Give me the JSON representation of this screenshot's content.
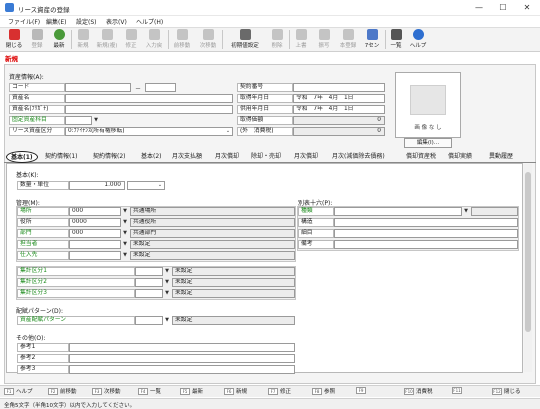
{
  "window": {
    "title": "リース資産の登録",
    "minimize": "—",
    "maximize": "☐",
    "close": "✕"
  },
  "menu": [
    "ファイル(F)",
    "編集(E)",
    "設定(S)",
    "表示(V)",
    "ヘルプ(H)"
  ],
  "toolbar": {
    "close": "閉じる",
    "register": "登録",
    "refresh": "最新",
    "new": "新規",
    "new_copy": "新規(複)",
    "edit": "修正",
    "import": "入力戻",
    "prev": "前移動",
    "next": "次移動",
    "initial_settings": "初期値設定",
    "delete": "削除",
    "overwrite": "上書",
    "copy": "振写",
    "this_period": "本登録",
    "fuzen": "7セン",
    "list": "一覧",
    "help": "ヘルプ"
  },
  "mode_label": "新規",
  "asset_info": {
    "header": "資産情報(A):",
    "code_label": "コード",
    "code_dash": "－",
    "name_label": "資産名",
    "kana_label": "資産名(ﾌﾘｶﾞﾅ)",
    "fixed_subject_label": "固定資産科目",
    "category_label": "リース資産区分",
    "category_value": "0:ﾌｧｲﾅﾝｽ(所有権移転)",
    "contract_no_label": "契約番号",
    "acquisition_date_label": "取得年月日",
    "acquisition_date_value": "令和　7年　4月　1日",
    "use_date_label": "供用年月日",
    "use_date_value": "令和　7年　4月　1日",
    "acquisition_price_label": "取得価額",
    "acquisition_price_value": "0",
    "tax_label": "(外　消費税)",
    "tax_value": "0"
  },
  "image_box": {
    "no_image": "画 像 な し",
    "edit_button": "編集(I)..."
  },
  "tabs": [
    "基本(1)",
    "契約情報(1)",
    "契約情報(2)",
    "基本(2)",
    "月次支払額",
    "月次償却",
    "除却・売却",
    "月次償却",
    "月次(減価除去債務)",
    "償却資産税",
    "償却実績",
    "異動履歴"
  ],
  "basic": {
    "header": "基本(K):",
    "qty_label": "数量・単位",
    "qty_value": "1.000",
    "management_header": "管理(M):",
    "mgmt_rows": [
      {
        "label": "場所",
        "code": "000",
        "name": "共通場所"
      },
      {
        "label": "役所",
        "code": "0000",
        "name": "共通役所"
      },
      {
        "label": "部門",
        "code": "000",
        "name": "共通部門"
      },
      {
        "label": "担当者",
        "code": "",
        "name": "未設定"
      },
      {
        "label": "仕入先",
        "code": "",
        "name": "未設定"
      }
    ],
    "aggregate_rows": [
      {
        "label": "集計区分1",
        "name": "未設定"
      },
      {
        "label": "集計区分2",
        "name": "未設定"
      },
      {
        "label": "集計区分3",
        "name": "未設定"
      }
    ],
    "allocation_header": "配賦パターン(D):",
    "allocation_label": "資産配賦パターン",
    "allocation_value": "未設定",
    "other_header": "その他(O):",
    "notes": [
      "参考1",
      "参考2",
      "参考3"
    ],
    "table16_header": "別表十六(P):",
    "table16_rows": [
      "種類",
      "構造",
      "細目",
      "備考"
    ]
  },
  "fkeys": [
    {
      "key": "F1",
      "label": "ヘルプ"
    },
    {
      "key": "F2",
      "label": "前移動"
    },
    {
      "key": "F3",
      "label": "次移動"
    },
    {
      "key": "F4",
      "label": "一覧"
    },
    {
      "key": "F5",
      "label": "最新"
    },
    {
      "key": "F6",
      "label": "新規"
    },
    {
      "key": "F7",
      "label": "修正"
    },
    {
      "key": "F8",
      "label": "参照"
    },
    {
      "key": "F9",
      "label": ""
    },
    {
      "key": "F10",
      "label": "消費税"
    },
    {
      "key": "F11",
      "label": ""
    },
    {
      "key": "F12",
      "label": "閉じる"
    }
  ],
  "status": "全角5文字（半角10文字）以内で入力してください。"
}
